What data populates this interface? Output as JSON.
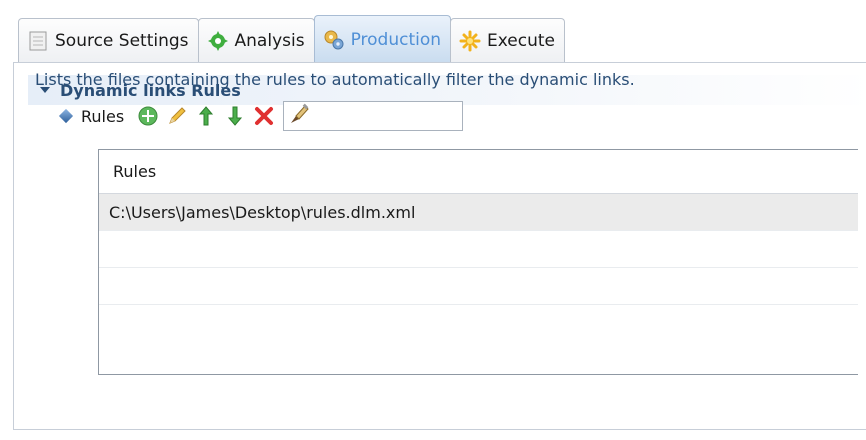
{
  "tabs": [
    {
      "label": "Source Settings",
      "icon": "document-icon",
      "active": false
    },
    {
      "label": "Analysis",
      "icon": "gear-leaf-icon",
      "active": false
    },
    {
      "label": "Production",
      "icon": "gears-icon",
      "active": true
    },
    {
      "label": "Execute",
      "icon": "sparkle-icon",
      "active": false
    }
  ],
  "section": {
    "title": "Dynamic links Rules",
    "description": "Lists the files containing the rules to automatically filter the dynamic links."
  },
  "rules": {
    "label": "Rules",
    "filter_value": "",
    "toolbar": [
      "add-icon",
      "edit-pencil-icon",
      "move-up-icon",
      "move-down-icon",
      "delete-icon",
      "filter-brush-icon"
    ]
  },
  "table": {
    "header": "Rules",
    "rows": [
      "C:\\Users\\James\\Desktop\\rules.dlm.xml",
      "",
      ""
    ]
  },
  "colors": {
    "accent": "#4f8fd6",
    "section_title": "#2a4e76",
    "selected_row": "#ebebeb"
  }
}
